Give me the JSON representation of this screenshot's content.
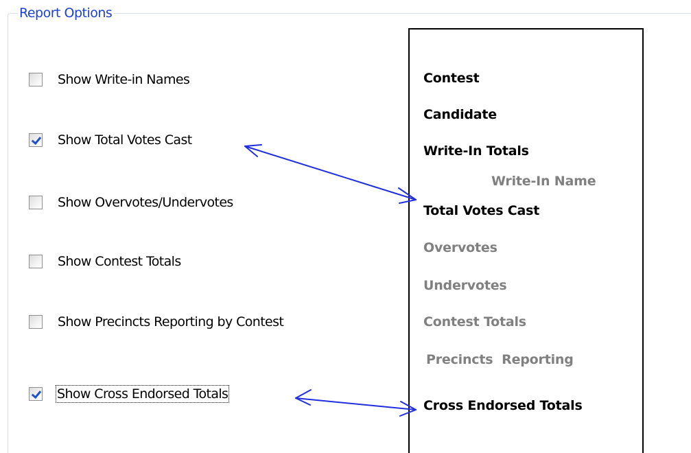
{
  "group": {
    "title": "Report Options"
  },
  "options": [
    {
      "label": "Show Write-in Names",
      "checked": false
    },
    {
      "label": "Show Total Votes Cast",
      "checked": true
    },
    {
      "label": "Show Overvotes/Undervotes",
      "checked": false
    },
    {
      "label": "Show Contest Totals",
      "checked": false
    },
    {
      "label": "Show Precincts Reporting by Contest",
      "checked": false
    },
    {
      "label": "Show Cross Endorsed Totals",
      "checked": true,
      "focused": true
    }
  ],
  "preview": {
    "items": [
      {
        "label": "Contest",
        "state": "on"
      },
      {
        "label": "Candidate",
        "state": "on"
      },
      {
        "label": "Write-In Totals",
        "state": "on"
      },
      {
        "label": "Write-In Name",
        "state": "off"
      },
      {
        "label": "Total Votes Cast",
        "state": "on"
      },
      {
        "label": "Overvotes",
        "state": "off"
      },
      {
        "label": "Undervotes",
        "state": "off"
      },
      {
        "label": "Contest Totals",
        "state": "off"
      },
      {
        "label": "Precincts  Reporting",
        "state": "off"
      },
      {
        "label": "Cross Endorsed Totals",
        "state": "on"
      }
    ]
  },
  "colors": {
    "legend_text": "#1c3fd6",
    "check_mark": "#2150c8",
    "arrow": "#1f2ee0",
    "enabled_text": "#000000",
    "disabled_text": "#808080"
  },
  "icons": {
    "checkbox": "checkbox-icon",
    "arrow": "double-headed-arrow-icon"
  }
}
